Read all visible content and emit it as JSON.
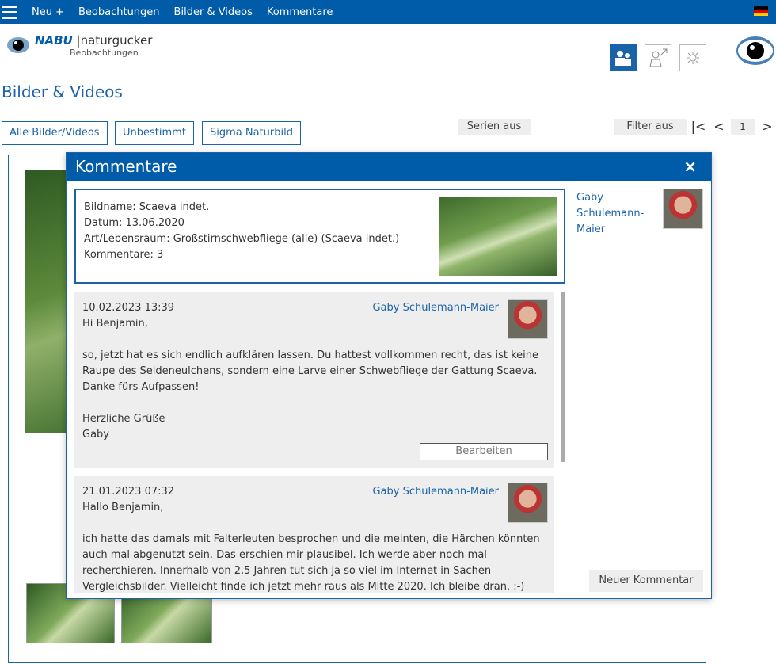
{
  "nav": {
    "items": [
      "Neu +",
      "Beobachtungen",
      "Bilder & Videos",
      "Kommentare"
    ]
  },
  "logo": {
    "nabu": "NABU",
    "brand": "naturgucker",
    "sub": "Beobachtungen"
  },
  "page": {
    "title": "Bilder & Videos"
  },
  "filters": {
    "all": "Alle Bilder/Videos",
    "unbestimmt": "Unbestimmt",
    "sigma": "Sigma Naturbild",
    "serien": "Serien aus",
    "filter": "Filter aus",
    "page_first": "|<",
    "page_prev": "<",
    "page_num": "1",
    "page_next": ">"
  },
  "modal": {
    "title": "Kommentare",
    "close": "×",
    "info": {
      "bildname": "Bildname: Scaeva indet.",
      "datum": "Datum: 13.06.2020",
      "art": "Art/Lebensraum: Großstirnschwebfliege (alle) (Scaeva indet.)",
      "kommentare": "Kommentare: 3"
    },
    "side_author": "Gaby Schulemann-Maier",
    "new_comment": "Neuer Kommentar",
    "comments": [
      {
        "date": "10.02.2023 13:39",
        "author": "Gaby Schulemann-Maier",
        "body": "Hi Benjamin,\n\nso, jetzt hat es sich endlich aufklären lassen. Du hattest vollkommen recht, das ist keine Raupe des Seideneulchens, sondern eine Larve einer Schwebfliege der Gattung Scaeva. Danke fürs Aufpassen!\n\nHerzliche Grüße\nGaby",
        "edit": "Bearbeiten"
      },
      {
        "date": "21.01.2023 07:32",
        "author": "Gaby Schulemann-Maier",
        "body": "Hallo Benjamin,\n\nich hatte das damals mit Falterleuten besprochen und die meinten, die Härchen könnten auch mal abgenutzt sein. Das erschien mir plausibel. Ich werde aber noch mal recherchieren. Innerhalb von 2,5 Jahren tut sich ja so viel im Internet in Sachen Vergleichsbilder. Vielleicht finde ich jetzt mehr raus als Mitte 2020. Ich bleibe dran. :-)"
      }
    ]
  }
}
